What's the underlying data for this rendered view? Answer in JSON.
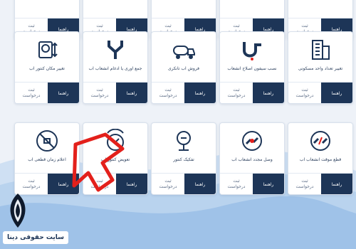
{
  "colors": {
    "navy": "#1d3557",
    "card_border": "#d9e1ec",
    "arrow_red": "#e3201b",
    "background": "#eef2f8"
  },
  "common": {
    "guide_label": "راهنما",
    "request_line1": "ثبت",
    "request_line2": "درخواست"
  },
  "rows": {
    "top": [
      {
        "title": "",
        "icon": "none"
      },
      {
        "title": "",
        "icon": "none"
      },
      {
        "title": "",
        "icon": "none"
      },
      {
        "title": "",
        "icon": "none"
      },
      {
        "title": "",
        "icon": "none"
      }
    ],
    "second": [
      {
        "title": "تغییر مکان کنتور آب",
        "icon": "meter-move-icon"
      },
      {
        "title": "جمع آوری یا ادغام انشعاب آب",
        "icon": "pipe-merge-icon"
      },
      {
        "title": "فروش آب تانکری",
        "icon": "water-tanker-icon"
      },
      {
        "title": "نصب سیفون اصلاح انشعاب",
        "icon": "siphon-pipe-icon"
      },
      {
        "title": "تغییر تعداد واحد مسکونی",
        "icon": "building-icon"
      }
    ],
    "third": [
      {
        "title": "اعلام زمان قطعی آب",
        "icon": "no-water-icon"
      },
      {
        "title": "تعویض کنتور آب",
        "icon": "meter-replace-icon"
      },
      {
        "title": "تفکیک کنتور",
        "icon": "meter-split-icon"
      },
      {
        "title": "وصل مجدد انشعاب آب",
        "icon": "reconnect-icon"
      },
      {
        "title": "قطع موقت انشعاب آب",
        "icon": "disconnect-icon"
      }
    ]
  },
  "watermark": {
    "brand_text": "سایت حقوقی دینا"
  }
}
